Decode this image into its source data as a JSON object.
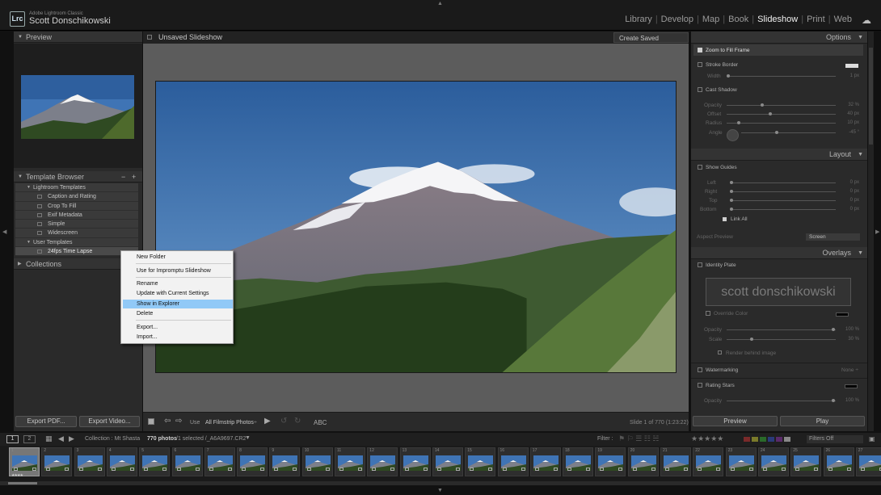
{
  "app": {
    "logo": "Lrc",
    "product": "Adobe Lightroom Classic",
    "user": "Scott Donschikowski"
  },
  "modules": [
    "Library",
    "Develop",
    "Map",
    "Book",
    "Slideshow",
    "Print",
    "Web"
  ],
  "active_module": "Slideshow",
  "left_panel": {
    "preview_title": "Preview",
    "template_browser_title": "Template Browser",
    "template_browser_minus": "−",
    "template_browser_plus": "+",
    "lightroom_templates": "Lightroom Templates",
    "templates": [
      "Caption and Rating",
      "Crop To Fill",
      "Exif Metadata",
      "Simple",
      "Widescreen"
    ],
    "user_templates": "User Templates",
    "user_template_item": "24fps Time Lapse",
    "collections_title": "Collections",
    "export_pdf": "Export PDF...",
    "export_video": "Export Video..."
  },
  "center": {
    "slideshow_name": "Unsaved Slideshow",
    "create_saved": "Create Saved Slideshow",
    "toolbar": {
      "use_label": "Use",
      "use_value": "All Filmstrip Photos",
      "abc": "ABC",
      "slide_info": "Slide 1 of 770 (1:23:22)"
    }
  },
  "context_menu": {
    "items": [
      "New Folder",
      "Use for Impromptu Slideshow",
      "Rename",
      "Update with Current Settings",
      "Show in Explorer",
      "Delete",
      "Export...",
      "Import..."
    ],
    "highlighted": "Show in Explorer"
  },
  "right_panel": {
    "options_title": "Options",
    "zoom_to_fill": "Zoom to Fill Frame",
    "stroke_border": "Stroke Border",
    "width_label": "Width",
    "width_value": "1 px",
    "cast_shadow": "Cast Shadow",
    "opacity_label": "Opacity",
    "opacity_value": "32 %",
    "offset_label": "Offset",
    "offset_value": "40 px",
    "radius_label": "Radius",
    "radius_value": "10 px",
    "angle_label": "Angle",
    "angle_value": "-45 °",
    "layout_title": "Layout",
    "show_guides": "Show Guides",
    "left_label": "Left",
    "right_label": "Right",
    "top_label": "Top",
    "bottom_label": "Bottom",
    "zero_px": "0 px",
    "link_all": "Link All",
    "aspect_preview_label": "Aspect Preview",
    "aspect_preview_value": "Screen",
    "overlays_title": "Overlays",
    "identity_plate": "Identity Plate",
    "identity_text": "scott donschikowski",
    "override_color": "Override Color",
    "ov_opacity_label": "Opacity",
    "ov_opacity_value": "100 %",
    "scale_label": "Scale",
    "scale_value": "30 %",
    "render_behind": "Render behind image",
    "watermarking": "Watermarking",
    "watermark_value": "None ÷",
    "rating_stars": "Rating Stars",
    "rs_opacity_label": "Opacity",
    "rs_opacity_value": "100 %",
    "preview_btn": "Preview",
    "play_btn": "Play"
  },
  "filmstrip_bar": {
    "page1": "1",
    "page2": "2",
    "source": "Collection : Mt Shasta",
    "count": "770 photos",
    "selection": "/1 selected /_A6A9697.CR2",
    "filter_label": "Filter :",
    "filters_off": "Filters Off"
  },
  "filmstrip": {
    "cells": [
      "1",
      "2",
      "3",
      "4",
      "5",
      "6",
      "7",
      "8",
      "9",
      "10",
      "11",
      "12",
      "13",
      "14",
      "15",
      "16",
      "17",
      "18",
      "19",
      "20",
      "21",
      "22",
      "23",
      "24",
      "25",
      "26",
      "27"
    ],
    "first_stars": "★★★★"
  },
  "colors": {
    "menu_highlight": "#91c9f7",
    "active_module": "#f0f0f0",
    "sky": "#3f74b5",
    "forest": "#2f4a22"
  }
}
